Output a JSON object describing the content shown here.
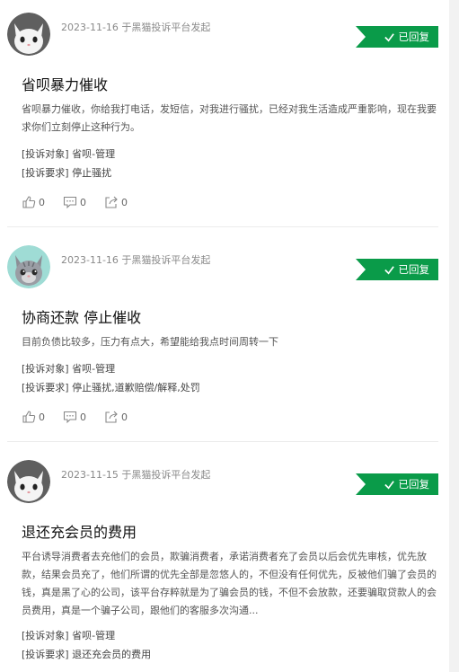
{
  "colors": {
    "badge_bg": "#0a9b49",
    "divider": "#ececec"
  },
  "complaints": [
    {
      "avatar_icon": "white-cat-avatar",
      "meta": "2023-11-16 于黑猫投诉平台发起",
      "status": "已回复",
      "title": "省呗暴力催收",
      "desc": "省呗暴力催收，你给我打电话，发短信，对我进行骚扰，已经对我生活造成严重影响，现在我要求你们立刻停止这种行为。",
      "target_label": "[投诉对象]",
      "target": "省呗-管理",
      "request_label": "[投诉要求]",
      "request": "停止骚扰",
      "likes": "0",
      "comments": "0",
      "shares": "0"
    },
    {
      "avatar_icon": "gray-tabby-cat-avatar",
      "meta": "2023-11-16 于黑猫投诉平台发起",
      "status": "已回复",
      "title": "协商还款 停止催收",
      "desc": "目前负债比较多，压力有点大，希望能给我点时间周转一下",
      "target_label": "[投诉对象]",
      "target": "省呗-管理",
      "request_label": "[投诉要求]",
      "request": "停止骚扰,道歉赔偿/解释,处罚",
      "likes": "0",
      "comments": "0",
      "shares": "0"
    },
    {
      "avatar_icon": "white-cat-avatar",
      "meta": "2023-11-15 于黑猫投诉平台发起",
      "status": "已回复",
      "title": "退还充会员的费用",
      "desc": "平台诱导消费者去充他们的会员，欺骗消费者，承诺消费者充了会员以后会优先审核，优先放款，结果会员充了，他们所谓的优先全部是忽悠人的，不但没有任何优先，反被他们骗了会员的钱，真是黑了心的公司，该平台存粹就是为了骗会员的钱，不但不会放款，还要骗取贷款人的会员费用，真是一个骗子公司，跟他们的客服多次沟通...",
      "target_label": "[投诉对象]",
      "target": "省呗-管理",
      "request_label": "[投诉要求]",
      "request": "退还充会员的费用"
    }
  ]
}
